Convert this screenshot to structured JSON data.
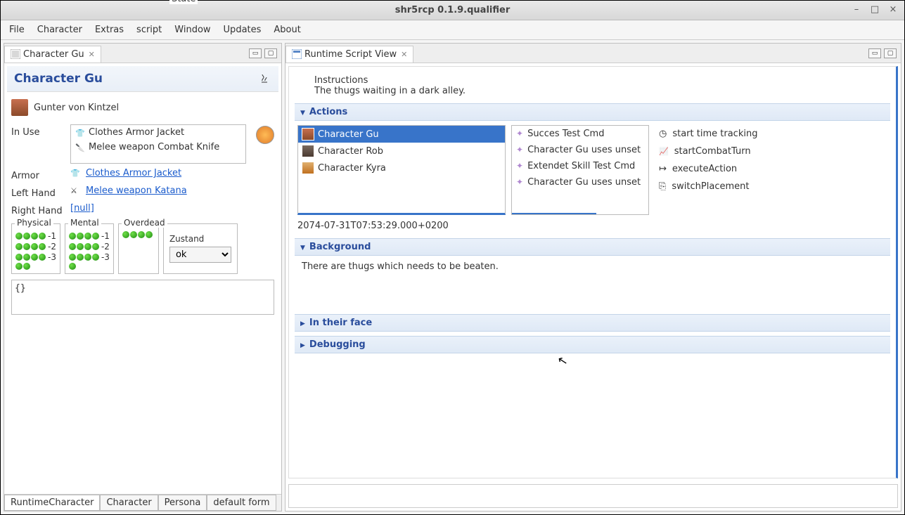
{
  "window": {
    "title": "shr5rcp 0.1.9.qualifier"
  },
  "menubar": [
    "File",
    "Character",
    "Extras",
    "script",
    "Window",
    "Updates",
    "About"
  ],
  "leftPanel": {
    "tab": "Character Gu",
    "title": "Character Gu",
    "characterName": "Gunter von Kintzel",
    "labels": {
      "inUse": "In Use",
      "armor": "Armor",
      "leftHand": "Left Hand",
      "rightHand": "Right Hand"
    },
    "inUseItems": [
      "Clothes Armor Jacket",
      "Melee weapon Combat Knife"
    ],
    "armorLink": "Clothes Armor Jacket",
    "leftHandLink": "Melee weapon Katana",
    "rightHandLink": "[null]",
    "stats": {
      "physical": "Physical",
      "mental": "Mental",
      "overdead": "Overdead",
      "state": "State"
    },
    "stateLabel": "Zustand",
    "stateValue": "ok",
    "braceText": "{}",
    "bottomTabs": [
      "RuntimeCharacter",
      "Character",
      "Persona",
      "default form"
    ]
  },
  "rightPanel": {
    "tab": "Runtime Script View",
    "instructionsTitle": "Instructions",
    "instructionsBody": "The thugs waiting in a dark alley.",
    "sections": {
      "actions": "Actions",
      "background": "Background",
      "inTheirFace": "In their face",
      "debugging": "Debugging"
    },
    "characterList": [
      "Character Gu",
      "Character Rob",
      "Character Kyra"
    ],
    "commandList": [
      "Succes Test Cmd",
      "Character Gu uses unset",
      "Extendet Skill Test Cmd",
      "Character Gu uses unset"
    ],
    "actionButtons": [
      "start time tracking",
      "startCombatTurn",
      "executeAction",
      "switchPlacement"
    ],
    "timestamp": "2074-07-31T07:53:29.000+0200",
    "backgroundText": "There are thugs which needs to be beaten."
  }
}
